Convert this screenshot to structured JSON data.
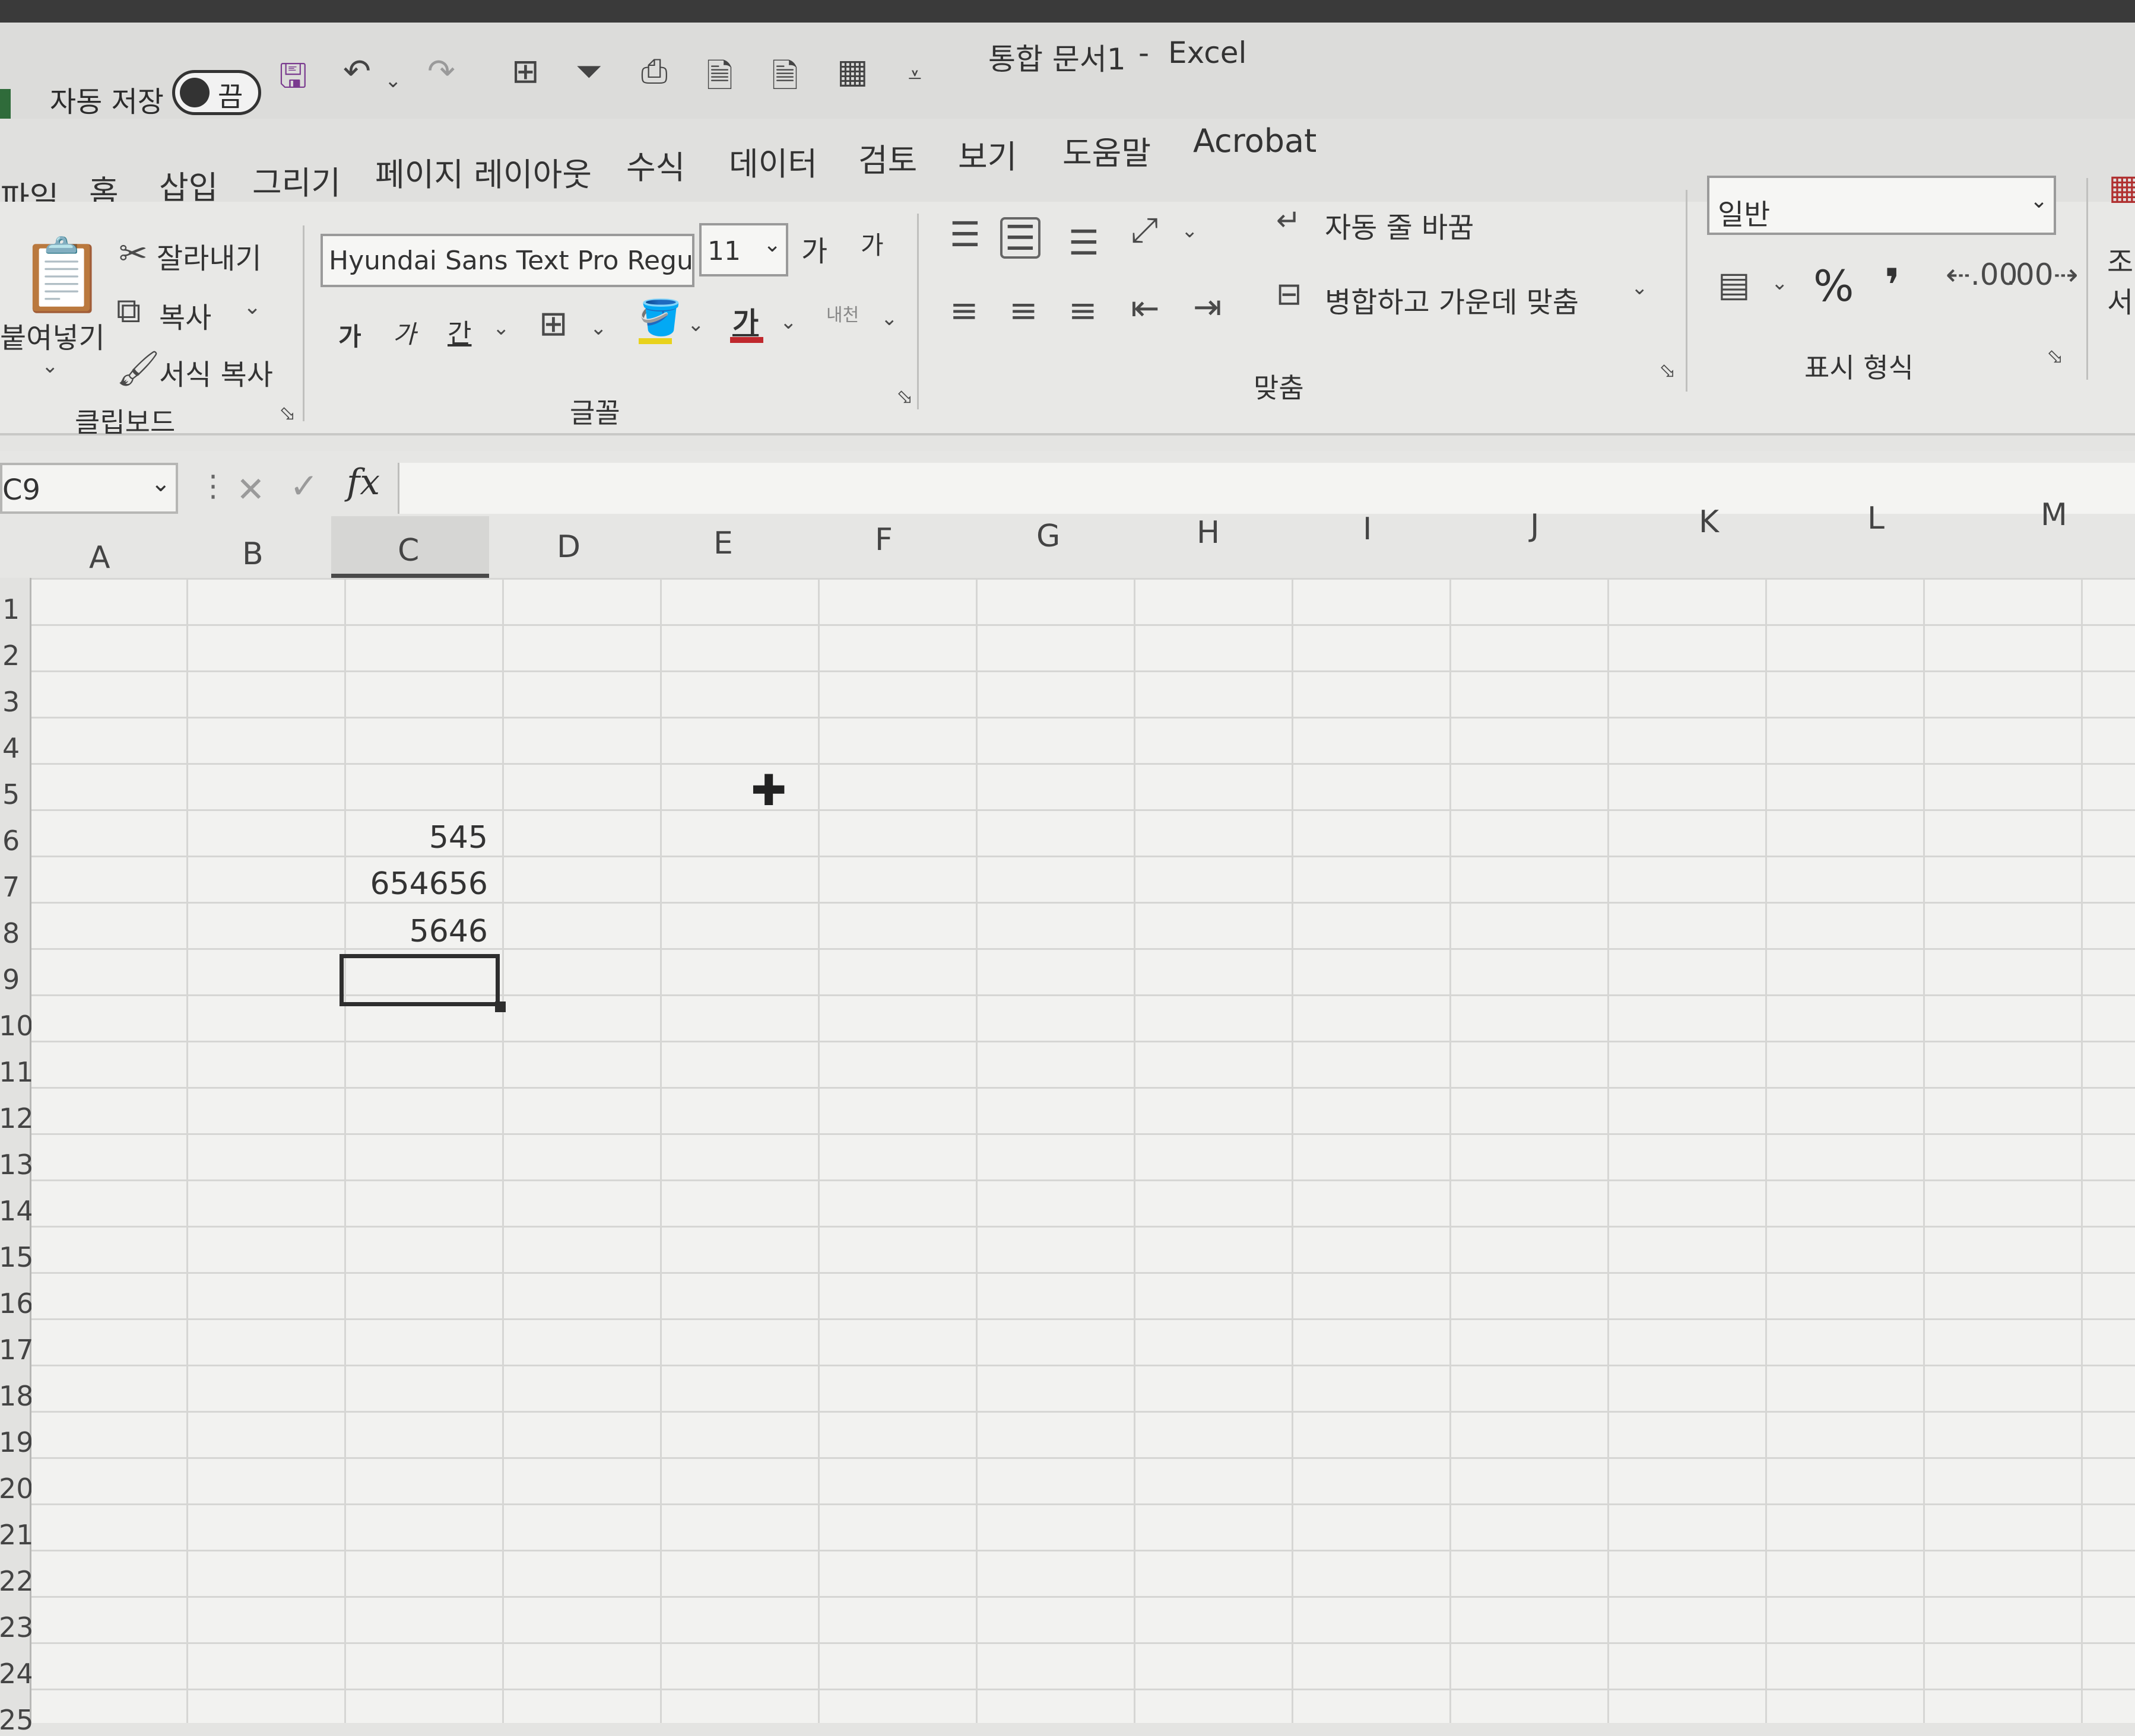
{
  "window": {
    "title": "통합 문서1",
    "app": "Excel"
  },
  "quick_access": {
    "autosave_label": "자동 저장",
    "autosave_state": "끔",
    "icons": [
      "save-icon",
      "undo-icon",
      "redo-icon",
      "table-icon",
      "filter-icon",
      "print-preview-icon",
      "page-icon",
      "page-icon",
      "grid-icon",
      "customize-dropdown-icon"
    ]
  },
  "tabs": [
    {
      "label": "파일"
    },
    {
      "label": "홈"
    },
    {
      "label": "삽입"
    },
    {
      "label": "그리기"
    },
    {
      "label": "페이지 레이아웃"
    },
    {
      "label": "수식"
    },
    {
      "label": "데이터"
    },
    {
      "label": "검토"
    },
    {
      "label": "보기"
    },
    {
      "label": "도움말"
    },
    {
      "label": "Acrobat"
    }
  ],
  "ribbon": {
    "clipboard": {
      "paste": "붙여넣기",
      "cut": "잘라내기",
      "copy": "복사",
      "format_painter": "서식 복사",
      "group_label": "클립보드"
    },
    "font": {
      "font_name": "Hyundai Sans Text Pro Regu",
      "font_size": "11",
      "grow": "가",
      "shrink": "가",
      "bold": "가",
      "italic": "가",
      "underline": "간",
      "font_color_glyph": "가",
      "phonetic": "내천",
      "group_label": "글꼴"
    },
    "alignment": {
      "wrap_text": "자동 줄 바꿈",
      "merge_center": "병합하고 가운데 맞춤",
      "group_label": "맞춤"
    },
    "number": {
      "format": "일반",
      "percent": "%",
      "comma": "❜",
      "group_label": "표시 형식"
    },
    "partial_right": [
      "조",
      "서"
    ]
  },
  "formula_bar": {
    "name_box": "C9",
    "fx": "fx",
    "value": ""
  },
  "columns": [
    "A",
    "B",
    "C",
    "D",
    "E",
    "F",
    "G",
    "H",
    "I",
    "J",
    "K",
    "L",
    "M"
  ],
  "selected_column": "C",
  "rows": [
    "1",
    "2",
    "3",
    "4",
    "5",
    "6",
    "7",
    "8",
    "9",
    "10",
    "11",
    "12",
    "13",
    "14",
    "15",
    "16",
    "17",
    "18",
    "19",
    "20",
    "21",
    "22",
    "23",
    "24",
    "25"
  ],
  "cells": {
    "C6": "545",
    "C7": "654656",
    "C8": "5646"
  },
  "selected_cell": "C9",
  "colors": {
    "save_icon": "#7a3b8f",
    "font_color_bar": "#c0282d",
    "fill_color_bar": "#e8d21c",
    "selection_border": "#2e2e2e"
  }
}
